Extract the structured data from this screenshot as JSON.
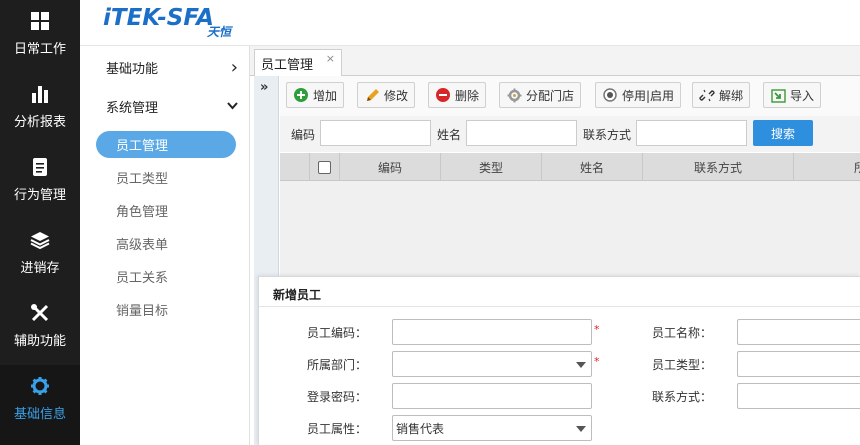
{
  "rail": {
    "items": [
      {
        "label": "日常工作",
        "icon": "grid-icon"
      },
      {
        "label": "分析报表",
        "icon": "bar-chart-icon"
      },
      {
        "label": "行为管理",
        "icon": "document-icon"
      },
      {
        "label": "进销存",
        "icon": "layers-icon"
      },
      {
        "label": "辅助功能",
        "icon": "tools-icon"
      },
      {
        "label": "基础信息",
        "icon": "gear-icon",
        "active": true
      }
    ]
  },
  "brand": {
    "logo_text": "iTEK-SFA",
    "logo_sub": "天恒",
    "color": "#1c6fc7"
  },
  "subnav": {
    "groups": [
      {
        "label": "基础功能",
        "chevron": "›"
      },
      {
        "label": "系统管理",
        "chevron": "⌄"
      }
    ],
    "items": [
      "员工管理",
      "员工类型",
      "角色管理",
      "高级表单",
      "员工关系",
      "销量目标"
    ],
    "active_index": 0
  },
  "tabs": [
    {
      "label": "员工管理",
      "close": "×"
    }
  ],
  "collapse_glyph": "»",
  "toolbar": {
    "buttons": [
      {
        "label": "增加",
        "icon": "plus-circle-icon"
      },
      {
        "label": "修改",
        "icon": "pencil-icon"
      },
      {
        "label": "删除",
        "icon": "minus-circle-icon"
      },
      {
        "label": "分配门店",
        "icon": "cog-icon"
      },
      {
        "label": "停用|启用",
        "icon": "radio-icon"
      },
      {
        "label": "解绑",
        "icon": "unlink-icon"
      },
      {
        "label": "导入",
        "icon": "import-icon"
      }
    ]
  },
  "search": {
    "code_label": "编码",
    "name_label": "姓名",
    "contact_label": "联系方式",
    "button_label": "搜索",
    "button_color": "#2f8fdf"
  },
  "table": {
    "headers": [
      "编码",
      "类型",
      "姓名",
      "联系方式",
      "所"
    ]
  },
  "modal": {
    "title": "新增员工",
    "fields": {
      "emp_code": "员工编码：",
      "emp_name": "员工名称：",
      "dept": "所属部门：",
      "emp_type": "员工类型：",
      "password": "登录密码：",
      "contact": "联系方式：",
      "attribute": "员工属性："
    },
    "required_mark": "*",
    "attribute_value": "销售代表"
  }
}
